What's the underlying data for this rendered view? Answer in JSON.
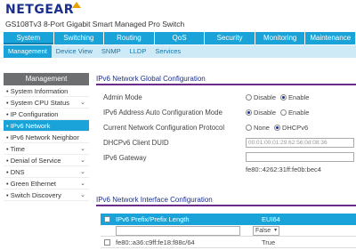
{
  "brand": {
    "logo": "NETGEAR",
    "product": "GS108Tv3 8-Port Gigabit Smart Managed Pro Switch"
  },
  "main_tabs": [
    "System",
    "Switching",
    "Routing",
    "QoS",
    "Security",
    "Monitoring",
    "Maintenance"
  ],
  "sub_tabs": [
    "Management",
    "Device View",
    "SNMP",
    "LLDP",
    "Services"
  ],
  "sidebar": {
    "header": "Management",
    "items": [
      {
        "label": "System Information",
        "chevron": false
      },
      {
        "label": "System CPU Status",
        "chevron": true
      },
      {
        "label": "IP Configuration",
        "chevron": false
      },
      {
        "label": "IPv6 Network Configuration",
        "chevron": false
      },
      {
        "label": "IPv6 Network Neighbor",
        "chevron": false
      },
      {
        "label": "Time",
        "chevron": true
      },
      {
        "label": "Denial of Service",
        "chevron": true
      },
      {
        "label": "DNS",
        "chevron": true
      },
      {
        "label": "Green Ethernet",
        "chevron": true
      },
      {
        "label": "Switch Discovery",
        "chevron": true
      }
    ]
  },
  "global_config": {
    "title": "IPv6 Network Global Configuration",
    "admin_mode": {
      "label": "Admin Mode",
      "options": [
        "Disable",
        "Enable"
      ],
      "selected": "Enable"
    },
    "auto_config": {
      "label": "IPv6 Address Auto Configuration Mode",
      "options": [
        "Disable",
        "Enable"
      ],
      "selected": "Disable"
    },
    "protocol": {
      "label": "Current Network Configuration Protocol",
      "options": [
        "None",
        "DHCPv6"
      ],
      "selected": "DHCPv6"
    },
    "duid": {
      "label": "DHCPv6 Client DUID",
      "value": "00:01:00:01:29:62:56:0d:08:36"
    },
    "gateway": {
      "label": "IPv6 Gateway",
      "value": "",
      "below": "fe80::4262:31ff:fe0b:bec4"
    }
  },
  "interface_config": {
    "title": "IPv6 Network Interface Configuration",
    "columns": [
      "IPv6 Prefix/Prefix Length",
      "EUI64"
    ],
    "new_row": {
      "prefix": "",
      "eui64": "False"
    },
    "rows": [
      {
        "prefix": "fe80::a36:c9ff:fe18:f88c/64",
        "eui64": "True"
      }
    ]
  }
}
